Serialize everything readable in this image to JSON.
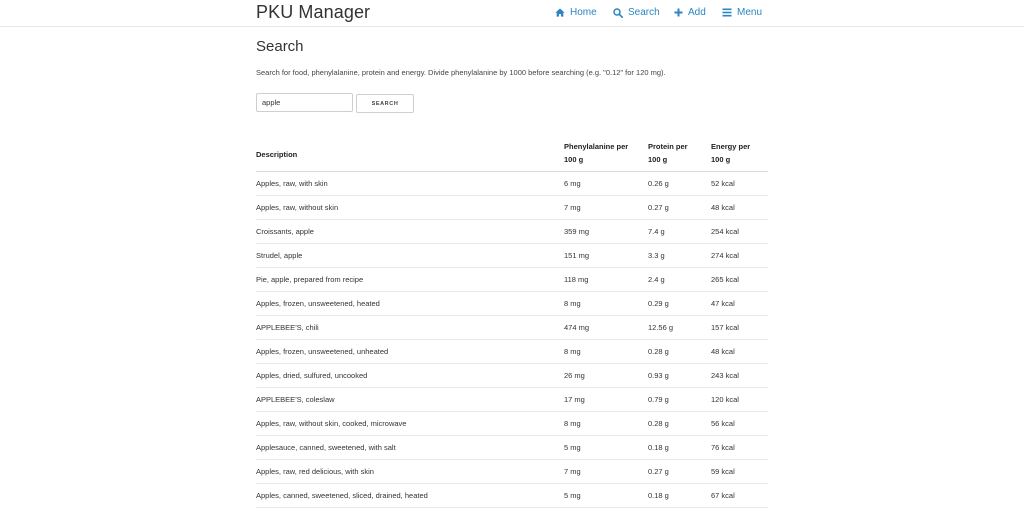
{
  "header": {
    "brand": "PKU Manager",
    "nav": [
      {
        "label": "Home",
        "icon": "home-icon"
      },
      {
        "label": "Search",
        "icon": "search-icon"
      },
      {
        "label": "Add",
        "icon": "plus-icon"
      },
      {
        "label": "Menu",
        "icon": "menu-icon"
      }
    ],
    "accent_color": "#2a86c4"
  },
  "page": {
    "title": "Search",
    "description": "Search for food, phenylalanine, protein and energy. Divide phenylalanine by 1000 before searching (e.g. \"0.12\" for 120 mg)."
  },
  "search": {
    "value": "apple",
    "button_label": "Search"
  },
  "table": {
    "headers": {
      "description": "Description",
      "phe_line1": "Phenylalanine per",
      "phe_line2": "100 g",
      "protein_line1": "Protein per",
      "protein_line2": "100 g",
      "energy_line1": "Energy per",
      "energy_line2": "100 g"
    },
    "rows": [
      {
        "description": "Apples, raw, with skin",
        "phe": "6 mg",
        "protein": "0.26 g",
        "energy": "52 kcal"
      },
      {
        "description": "Apples, raw, without skin",
        "phe": "7 mg",
        "protein": "0.27 g",
        "energy": "48 kcal"
      },
      {
        "description": "Croissants, apple",
        "phe": "359 mg",
        "protein": "7.4 g",
        "energy": "254 kcal"
      },
      {
        "description": "Strudel, apple",
        "phe": "151 mg",
        "protein": "3.3 g",
        "energy": "274 kcal"
      },
      {
        "description": "Pie, apple, prepared from recipe",
        "phe": "118 mg",
        "protein": "2.4 g",
        "energy": "265 kcal"
      },
      {
        "description": "Apples, frozen, unsweetened, heated",
        "phe": "8 mg",
        "protein": "0.29 g",
        "energy": "47 kcal"
      },
      {
        "description": "APPLEBEE'S, chili",
        "phe": "474 mg",
        "protein": "12.56 g",
        "energy": "157 kcal"
      },
      {
        "description": "Apples, frozen, unsweetened, unheated",
        "phe": "8 mg",
        "protein": "0.28 g",
        "energy": "48 kcal"
      },
      {
        "description": "Apples, dried, sulfured, uncooked",
        "phe": "26 mg",
        "protein": "0.93 g",
        "energy": "243 kcal"
      },
      {
        "description": "APPLEBEE'S, coleslaw",
        "phe": "17 mg",
        "protein": "0.79 g",
        "energy": "120 kcal"
      },
      {
        "description": "Apples, raw, without skin, cooked, microwave",
        "phe": "8 mg",
        "protein": "0.28 g",
        "energy": "56 kcal"
      },
      {
        "description": "Applesauce, canned, sweetened, with salt",
        "phe": "5 mg",
        "protein": "0.18 g",
        "energy": "76 kcal"
      },
      {
        "description": "Apples, raw, red delicious, with skin",
        "phe": "7 mg",
        "protein": "0.27 g",
        "energy": "59 kcal"
      },
      {
        "description": "Apples, canned, sweetened, sliced, drained, heated",
        "phe": "5 mg",
        "protein": "0.18 g",
        "energy": "67 kcal"
      }
    ]
  }
}
